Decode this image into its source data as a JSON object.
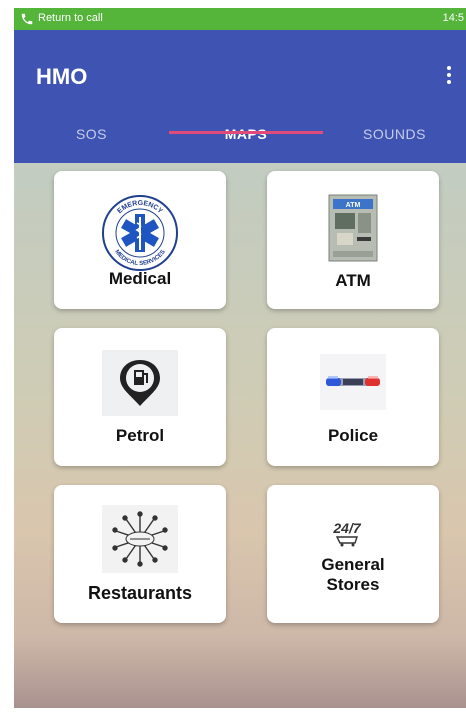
{
  "status_bar": {
    "call_text": "Return to call",
    "time": "14:5",
    "phone_icon": "phone-icon"
  },
  "app_bar": {
    "title": "HMO",
    "menu_icon": "more-vert-icon"
  },
  "tabs": [
    {
      "label": "SOS",
      "active": false
    },
    {
      "label": "MAPS",
      "active": true
    },
    {
      "label": "SOUNDS",
      "active": false
    }
  ],
  "colors": {
    "status_bar": "#55b43a",
    "app_bar": "#3f54b2",
    "tab_indicator": "#e14b7a"
  },
  "cards": [
    {
      "label": "Medical",
      "icon": "medical-emblem-icon",
      "badge_top": "EMERGENCY",
      "badge_bottom": "MEDICAL SERVICES"
    },
    {
      "label": "ATM",
      "icon": "atm-machine-icon",
      "sign": "ATM"
    },
    {
      "label": "Petrol",
      "icon": "fuel-pump-icon"
    },
    {
      "label": "Police",
      "icon": "police-light-icon"
    },
    {
      "label": "Restaurants",
      "icon": "restaurant-icon"
    },
    {
      "label": "General Stores",
      "label_line1": "General",
      "label_line2": "Stores",
      "icon": "store-24-7-icon",
      "badge": "24/7"
    }
  ]
}
